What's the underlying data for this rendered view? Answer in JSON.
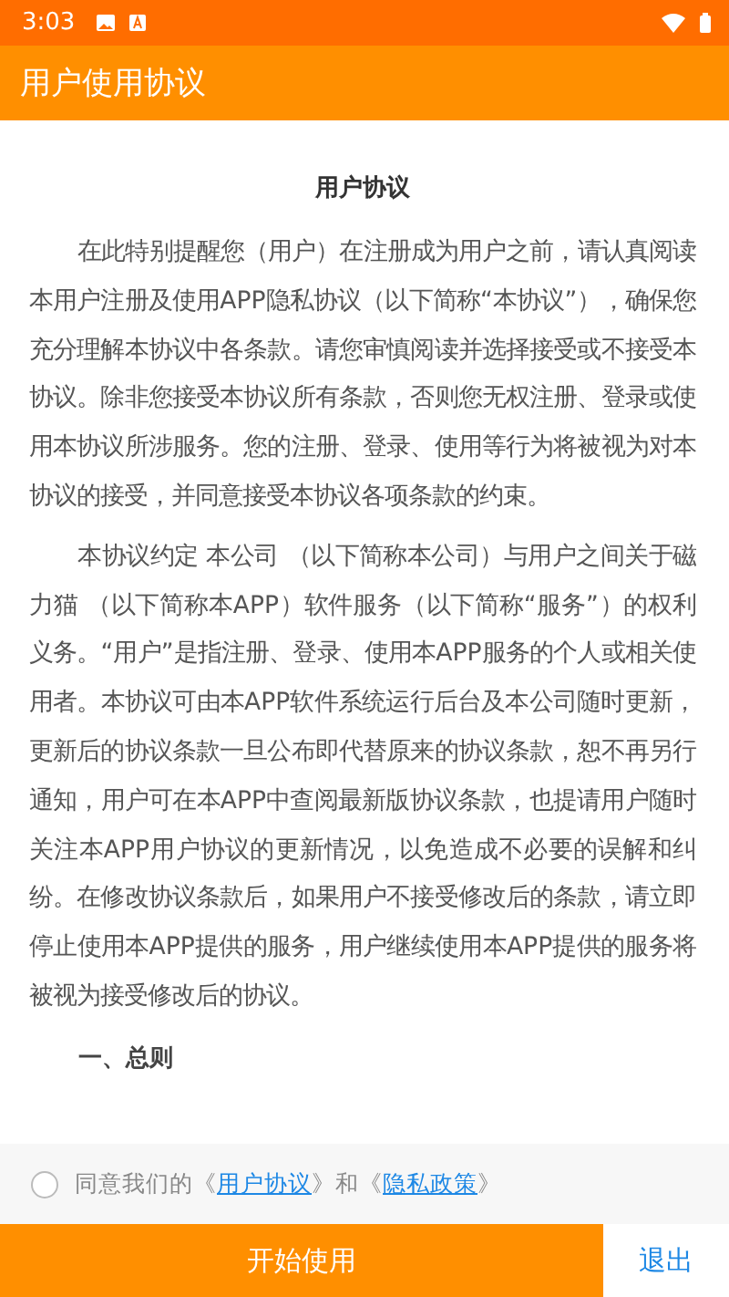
{
  "status_bar": {
    "time": "3:03"
  },
  "app_bar": {
    "title": "用户使用协议"
  },
  "document": {
    "title": "用户协议",
    "paragraphs": [
      "在此特别提醒您（用户）在注册成为用户之前，请认真阅读本用户注册及使用APP隐私协议（以下简称“本协议”），确保您充分理解本协议中各条款。请您审慎阅读并选择接受或不接受本协议。除非您接受本协议所有条款，否则您无权注册、登录或使用本协议所涉服务。您的注册、登录、使用等行为将被视为对本协议的接受，并同意接受本协议各项条款的约束。",
      "本协议约定 本公司 （以下简称本公司）与用户之间关于磁力猫 （以下简称本APP）软件服务（以下简称“服务”）的权利义务。“用户”是指注册、登录、使用本APP服务的个人或相关使用者。本协议可由本APP软件系统运行后台及本公司随时更新，更新后的协议条款一旦公布即代替原来的协议条款，恕不再另行通知，用户可在本APP中查阅最新版协议条款，也提请用户随时关注本APP用户协议的更新情况，以免造成不必要的误解和纠纷。在修改协议条款后，如果用户不接受修改后的条款，请立即停止使用本APP提供的服务，用户继续使用本APP提供的服务将被视为接受修改后的协议。"
    ],
    "section_heading": "一、总则"
  },
  "consent": {
    "checked": false,
    "prefix": "同意我们的《",
    "link_1": "用户协议",
    "middle": "》和《",
    "link_2": "隐私政策",
    "suffix": "》"
  },
  "buttons": {
    "start": "开始使用",
    "exit": "退出"
  }
}
